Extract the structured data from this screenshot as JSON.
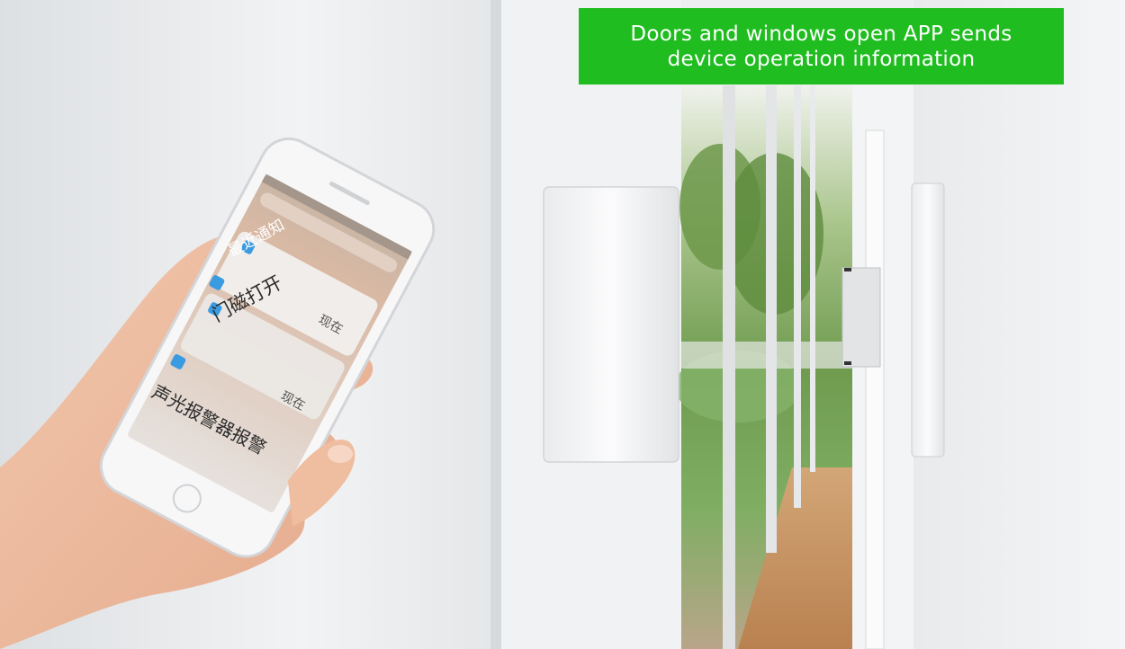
{
  "banner": {
    "line1": "Doors and windows open APP sends",
    "line2": "device operation information",
    "color": "#1fbd1f"
  },
  "phone": {
    "section_title": "最近通知",
    "notifications": [
      {
        "text": "门磁打开",
        "time": "现在",
        "icon": "app-icon"
      },
      {
        "text": "声光报警器报警",
        "time": "现在",
        "icon": "app-icon"
      }
    ]
  }
}
